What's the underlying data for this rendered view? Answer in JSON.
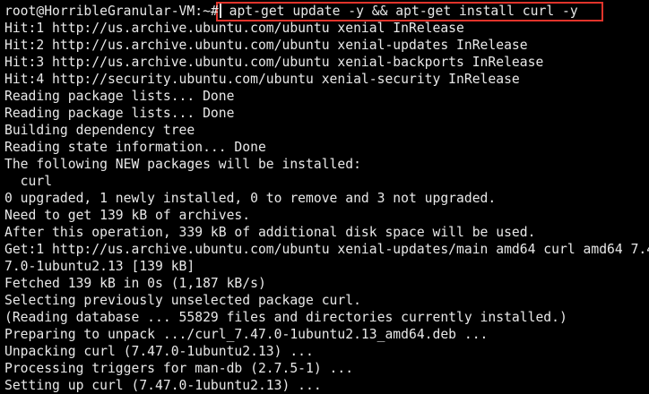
{
  "terminal": {
    "prompt": "root@HorribleGranular-VM:~#",
    "command": "apt-get update -y && apt-get install curl -y",
    "highlight_color": "#e0342b",
    "text_color": "#e8e8e8",
    "background_color": "#000000",
    "output": [
      "Hit:1 http://us.archive.ubuntu.com/ubuntu xenial InRelease",
      "Hit:2 http://us.archive.ubuntu.com/ubuntu xenial-updates InRelease",
      "Hit:3 http://us.archive.ubuntu.com/ubuntu xenial-backports InRelease",
      "Hit:4 http://security.ubuntu.com/ubuntu xenial-security InRelease",
      "Reading package lists... Done",
      "Reading package lists... Done",
      "Building dependency tree",
      "Reading state information... Done",
      "The following NEW packages will be installed:",
      "  curl",
      "0 upgraded, 1 newly installed, 0 to remove and 3 not upgraded.",
      "Need to get 139 kB of archives.",
      "After this operation, 339 kB of additional disk space will be used.",
      "Get:1 http://us.archive.ubuntu.com/ubuntu xenial-updates/main amd64 curl amd64 7.47.0-1ubuntu2.13 [139 kB]",
      "7.0-1ubuntu2.13 [139 kB]",
      "Fetched 139 kB in 0s (1,187 kB/s)",
      "Selecting previously unselected package curl.",
      "(Reading database ... 55829 files and directories currently installed.)",
      "Preparing to unpack .../curl_7.47.0-1ubuntu2.13_amd64.deb ...",
      "Unpacking curl (7.47.0-1ubuntu2.13) ...",
      "Processing triggers for man-db (2.7.5-1) ...",
      "Setting up curl (7.47.0-1ubuntu2.13) ..."
    ]
  }
}
